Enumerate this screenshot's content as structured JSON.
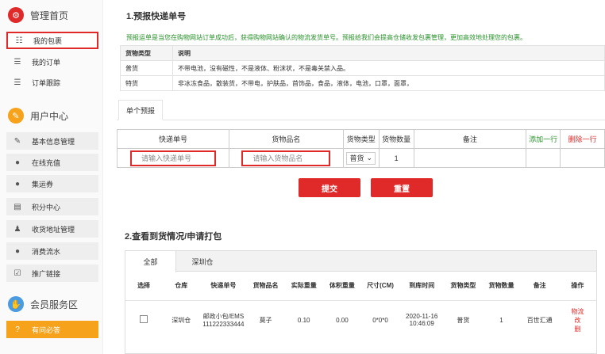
{
  "sidebar": {
    "sec1": {
      "title": "管理首页",
      "icon": "gear-icon"
    },
    "items1": [
      {
        "label": "我的包裹",
        "icon": "grid-list-icon"
      },
      {
        "label": "我的订单",
        "icon": "list-icon"
      },
      {
        "label": "订单跟踪",
        "icon": "list-icon"
      }
    ],
    "sec2": {
      "title": "用户中心",
      "icon": "pencil-icon"
    },
    "items2": [
      {
        "label": "基本信息管理",
        "icon": "edit-icon"
      },
      {
        "label": "在线充值",
        "icon": "coin-icon"
      },
      {
        "label": "集运券",
        "icon": "coin-icon"
      },
      {
        "label": "积分中心",
        "icon": "document-icon"
      },
      {
        "label": "收货地址管理",
        "icon": "user-icon"
      },
      {
        "label": "消费流水",
        "icon": "coin-icon"
      },
      {
        "label": "推广链接",
        "icon": "checkbox-icon"
      }
    ],
    "sec3": {
      "title": "会员服务区",
      "icon": "handshake-icon"
    },
    "items3": [
      {
        "label": "有问必答",
        "icon": "question-icon"
      }
    ]
  },
  "preforecast": {
    "title": "1.预报快递单号",
    "notice": "预报运单是当您在购物网站订单成功后，获得购物网站确认的物流发货单号。预报给我们会提高仓储收发包裹管理，更加高效地处理您的包裹。",
    "type_table": {
      "headers": [
        "货物类型",
        "说明"
      ],
      "rows": [
        [
          "普货",
          "不带电池，没有磁性，不是液体、粉沫状，不是毒关禁入品。"
        ],
        [
          "特货",
          "非冰冻食品，散装货，不带电，护肤品，首饰品，食品，液体，电池，口罩，面罩，"
        ]
      ]
    },
    "tab": "单个预报",
    "form": {
      "headers": [
        "快递单号",
        "货物品名",
        "货物类型",
        "货物数量",
        "备注"
      ],
      "add_row": "添加一行",
      "delete_row": "删除一行",
      "tracking_placeholder": "请输入快递单号",
      "name_placeholder": "请输入货物品名",
      "type_value": "普货",
      "quantity": "1"
    },
    "submit": "提交",
    "reset": "重置"
  },
  "arrivals": {
    "title": "2.查看到货情况/申请打包",
    "tabs": [
      "全部",
      "深圳仓"
    ],
    "headers": [
      "选择",
      "仓库",
      "快递单号",
      "货物品名",
      "实际重量",
      "体积重量",
      "尺寸(CM)",
      "到库时间",
      "货物类型",
      "货物数量",
      "备注",
      "操作"
    ],
    "row": {
      "warehouse": "深圳仓",
      "tracking_line1": "邮政小包/EMS",
      "tracking_line2": "111222333444",
      "name": "莫子",
      "actual_weight": "0.10",
      "volume_weight": "0.00",
      "size": "0*0*0",
      "date": "2020-11-16",
      "time": "10:46:09",
      "type": "普货",
      "quantity": "1",
      "remark": "百世汇通",
      "ops": [
        "物流",
        "改",
        "删"
      ]
    }
  },
  "colors": {
    "red": "#e02a2a",
    "green": "#27902a",
    "orange": "#f7a21b"
  }
}
